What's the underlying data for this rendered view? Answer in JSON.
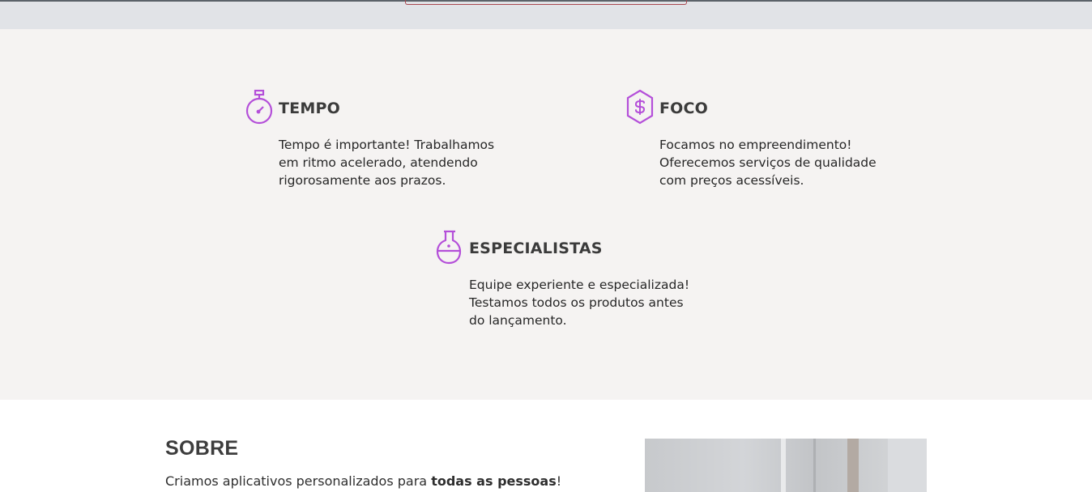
{
  "accent_color": "#b44fd9",
  "features": [
    {
      "icon": "stopwatch-icon",
      "title": "TEMPO",
      "lines": [
        "Tempo é importante! Trabalhamos",
        "em ritmo acelerado, atendendo",
        "rigorosamente aos prazos."
      ]
    },
    {
      "icon": "dollar-hexagon-icon",
      "title": "FOCO",
      "lines": [
        "Focamos no empreendimento!",
        "Oferecemos serviços de qualidade",
        "com preços acessíveis."
      ]
    },
    {
      "icon": "flask-icon",
      "title": "ESPECIALISTAS",
      "lines": [
        "Equipe experiente e especializada!",
        "Testamos todos os produtos antes",
        "do lançamento."
      ]
    }
  ],
  "about": {
    "title": "SOBRE",
    "text_before": "Criamos aplicativos personalizados para ",
    "text_bold": "todas as pessoas",
    "text_after": "!"
  }
}
